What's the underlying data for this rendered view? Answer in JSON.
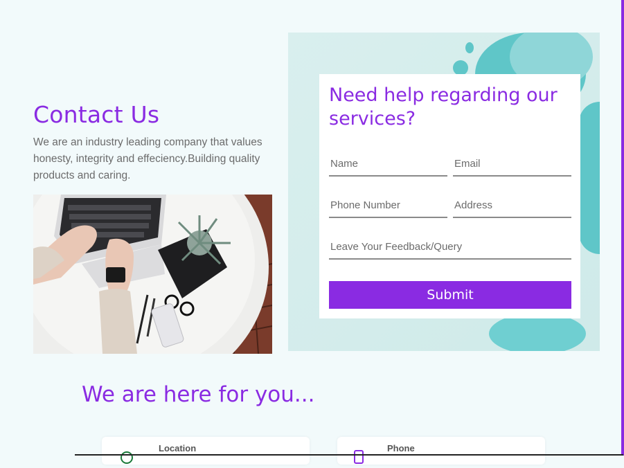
{
  "contact": {
    "title": "Contact Us",
    "description": "We are an industry leading company that values honesty, integrity and effeciency.Building quality products and caring."
  },
  "form": {
    "heading": "Need help regarding our services?",
    "name_placeholder": "Name",
    "email_placeholder": "Email",
    "phone_placeholder": "Phone Number",
    "address_placeholder": "Address",
    "feedback_placeholder": "Leave Your Feedback/Query",
    "submit_label": "Submit"
  },
  "here": {
    "title": "We are here for you..."
  },
  "info_cards": [
    {
      "label": "Location",
      "icon": "location-pin-icon"
    },
    {
      "label": "Phone",
      "icon": "phone-icon"
    }
  ],
  "colors": {
    "accent": "#8a2be2",
    "background": "#f2fafb",
    "panel": "#d4edec",
    "teal": "#5fc6c8"
  }
}
